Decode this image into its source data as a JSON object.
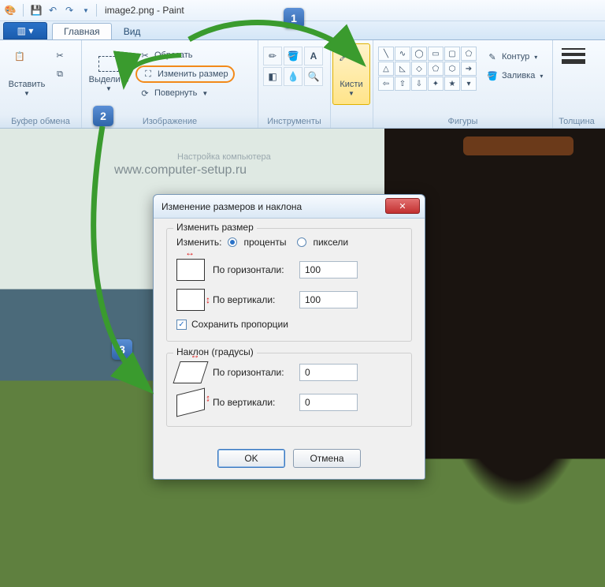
{
  "titlebar": {
    "title": "image2.png - Paint"
  },
  "tabs": {
    "main": "Главная",
    "view": "Вид"
  },
  "ribbon": {
    "clipboard": {
      "paste": "Вставить",
      "label": "Буфер обмена"
    },
    "image": {
      "select": "Выделить",
      "crop": "Обрезать",
      "resize": "Изменить размер",
      "rotate": "Повернуть",
      "label": "Изображение"
    },
    "tools": {
      "label": "Инструменты"
    },
    "brushes": {
      "btn": "Кисти"
    },
    "shapes": {
      "outline": "Контур",
      "fill": "Заливка",
      "label": "Фигуры"
    },
    "size": {
      "label": "Толщина"
    }
  },
  "watermark": {
    "line1": "Настройка компьютера",
    "line2": "www.computer-setup.ru"
  },
  "dialog": {
    "title": "Изменение размеров и наклона",
    "resize_legend": "Изменить размер",
    "by_label": "Изменить:",
    "percent": "проценты",
    "pixels": "пиксели",
    "horiz": "По горизонтали:",
    "vert": "По вертикали:",
    "h_val": "100",
    "v_val": "100",
    "aspect": "Сохранить пропорции",
    "skew_legend": "Наклон (градусы)",
    "skew_h_val": "0",
    "skew_v_val": "0",
    "ok": "OK",
    "cancel": "Отмена"
  },
  "callouts": {
    "c1": "1",
    "c2": "2",
    "c3": "3"
  }
}
